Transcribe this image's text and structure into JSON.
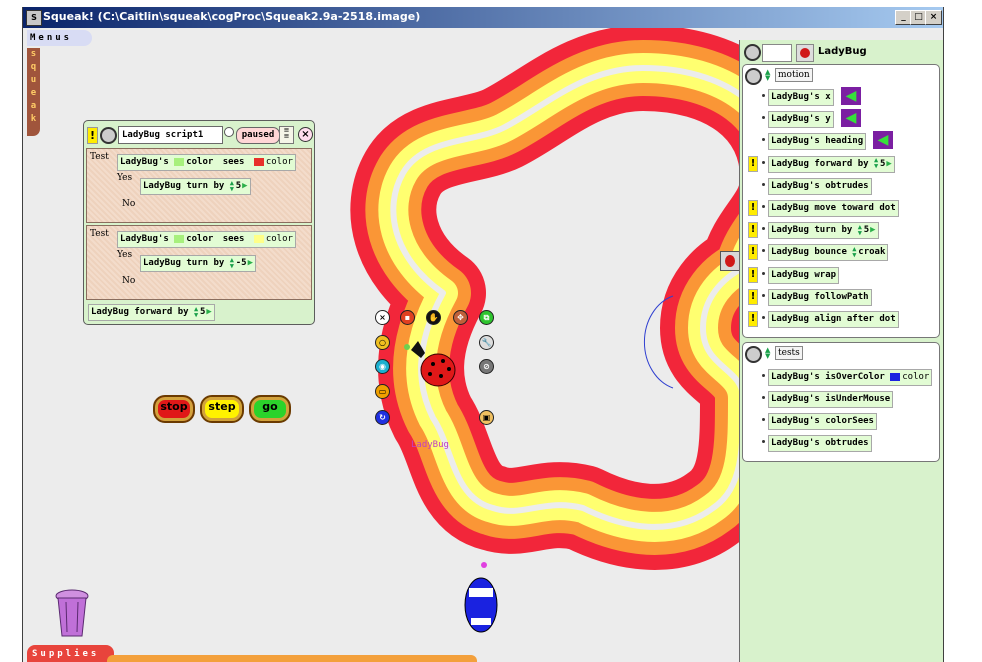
{
  "window": {
    "title": "Squeak! (C:\\Caitlin\\squeak\\cogProc\\Squeak2.9a-2518.image)",
    "min_label": "_",
    "max_label": "□",
    "close_label": "×"
  },
  "flaps": {
    "menus": "Menus",
    "squeak": [
      "s",
      "q",
      "u",
      "e",
      "a",
      "k"
    ],
    "supplies": "Supplies"
  },
  "script": {
    "bang": "!",
    "name": "LadyBug script1",
    "status": "paused",
    "close": "×",
    "tests": [
      {
        "test_label": "Test",
        "yes_label": "Yes",
        "no_label": "No",
        "subject": "LadyBug's",
        "attr": "color",
        "verb": "sees",
        "see_color": "color",
        "see_swatch": "#e8302a",
        "cmd_obj": "LadyBug",
        "cmd": "turn by",
        "value": "5"
      },
      {
        "test_label": "Test",
        "yes_label": "Yes",
        "no_label": "No",
        "subject": "LadyBug's",
        "attr": "color",
        "verb": "sees",
        "see_color": "color",
        "see_swatch": "#ffff88",
        "cmd_obj": "LadyBug",
        "cmd": "turn by",
        "value": "-5"
      }
    ],
    "footer": {
      "obj": "LadyBug",
      "cmd": "forward by",
      "value": "5"
    }
  },
  "controls": {
    "stop": "stop",
    "step": "step",
    "go": "go"
  },
  "morph_label": "LadyBug",
  "viewer": {
    "object_name": "LadyBug",
    "motion_category": "motion",
    "tests_category": "tests",
    "motion_rows": [
      {
        "bang": false,
        "obj": "LadyBug's",
        "cmd": "x",
        "arrow": true
      },
      {
        "bang": false,
        "obj": "LadyBug's",
        "cmd": "y",
        "arrow": true
      },
      {
        "bang": false,
        "obj": "LadyBug's",
        "cmd": "heading",
        "arrow": true
      },
      {
        "bang": true,
        "obj": "LadyBug",
        "cmd": "forward by",
        "value": "5"
      },
      {
        "bang": false,
        "obj": "LadyBug's",
        "cmd": "obtrudes"
      },
      {
        "bang": true,
        "obj": "LadyBug",
        "cmd": "move toward",
        "extra": "dot"
      },
      {
        "bang": true,
        "obj": "LadyBug",
        "cmd": "turn by",
        "value": "5"
      },
      {
        "bang": true,
        "obj": "LadyBug",
        "cmd": "bounce",
        "extra": "croak"
      },
      {
        "bang": true,
        "obj": "LadyBug",
        "cmd": "wrap"
      },
      {
        "bang": true,
        "obj": "LadyBug",
        "cmd": "followPath"
      },
      {
        "bang": true,
        "obj": "LadyBug",
        "cmd": "align after",
        "extra": "dot"
      }
    ],
    "test_rows": [
      {
        "obj": "LadyBug's",
        "cmd": "isOverColor",
        "extra": "color"
      },
      {
        "obj": "LadyBug's",
        "cmd": "isUnderMouse"
      },
      {
        "obj": "LadyBug's",
        "cmd": "colorSees"
      },
      {
        "obj": "LadyBug's",
        "cmd": "obtrudes"
      }
    ]
  },
  "colors": {
    "red": "#f2263a",
    "orange": "#fa9636",
    "yellow": "#ffff70",
    "world": "#ececec",
    "viewer": "#d8f2cc"
  }
}
